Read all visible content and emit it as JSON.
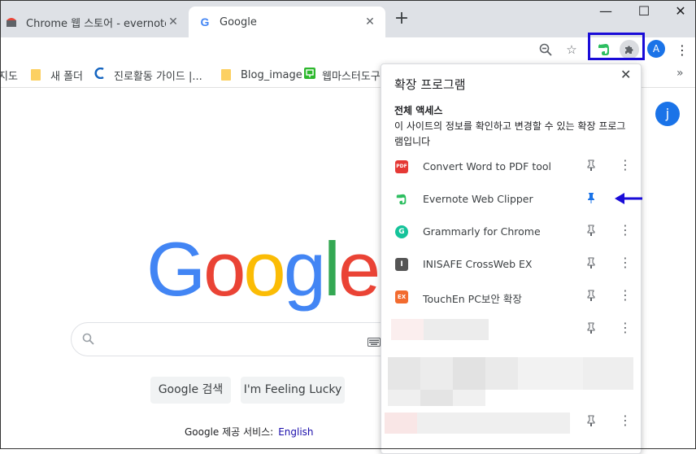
{
  "tabs": [
    {
      "title": "Chrome 웹 스토어 - evernote",
      "active": false
    },
    {
      "title": "Google",
      "active": true
    }
  ],
  "toolbar": {
    "profile_initial": "A"
  },
  "bookmarks": [
    {
      "label": "지도",
      "icon": "map-icon"
    },
    {
      "label": "새 폴더",
      "icon": "folder-icon"
    },
    {
      "label": "진로활동 가이드 |...",
      "icon": "site-icon"
    },
    {
      "label": "Blog_image",
      "icon": "folder-icon"
    },
    {
      "label": "웹마스터도구",
      "icon": "site-icon"
    }
  ],
  "page": {
    "logo": [
      "G",
      "o",
      "o",
      "g",
      "l",
      "e"
    ],
    "search_button": "Google 검색",
    "lucky_button": "I'm Feeling Lucky",
    "footer_text": "Google 제공 서비스:",
    "footer_link": "English",
    "account_initial": "j"
  },
  "popup": {
    "title": "확장 프로그램",
    "section": "전체 액세스",
    "description": "이 사이트의 정보를 확인하고 변경할 수 있는 확장 프로그램입니다",
    "extensions": [
      {
        "name": "Convert Word to PDF tool",
        "icon_text": "PDF",
        "color": "#e53935",
        "pinned": false
      },
      {
        "name": "Evernote Web Clipper",
        "icon_text": "",
        "color": "#2dbe60",
        "pinned": true
      },
      {
        "name": "Grammarly for Chrome",
        "icon_text": "G",
        "color": "#15c39a",
        "pinned": false
      },
      {
        "name": "INISAFE CrossWeb EX",
        "icon_text": "I",
        "color": "#555555",
        "pinned": false
      },
      {
        "name": "TouchEn PC보안 확장",
        "icon_text": "EX",
        "color": "#f26b2f",
        "pinned": false
      }
    ]
  },
  "colors": {
    "highlight": "#1a0cd8",
    "pin_active": "#1a73e8",
    "google_blue": "#4285f4",
    "google_red": "#ea4335",
    "google_yellow": "#fbbc05",
    "google_green": "#34a853"
  }
}
